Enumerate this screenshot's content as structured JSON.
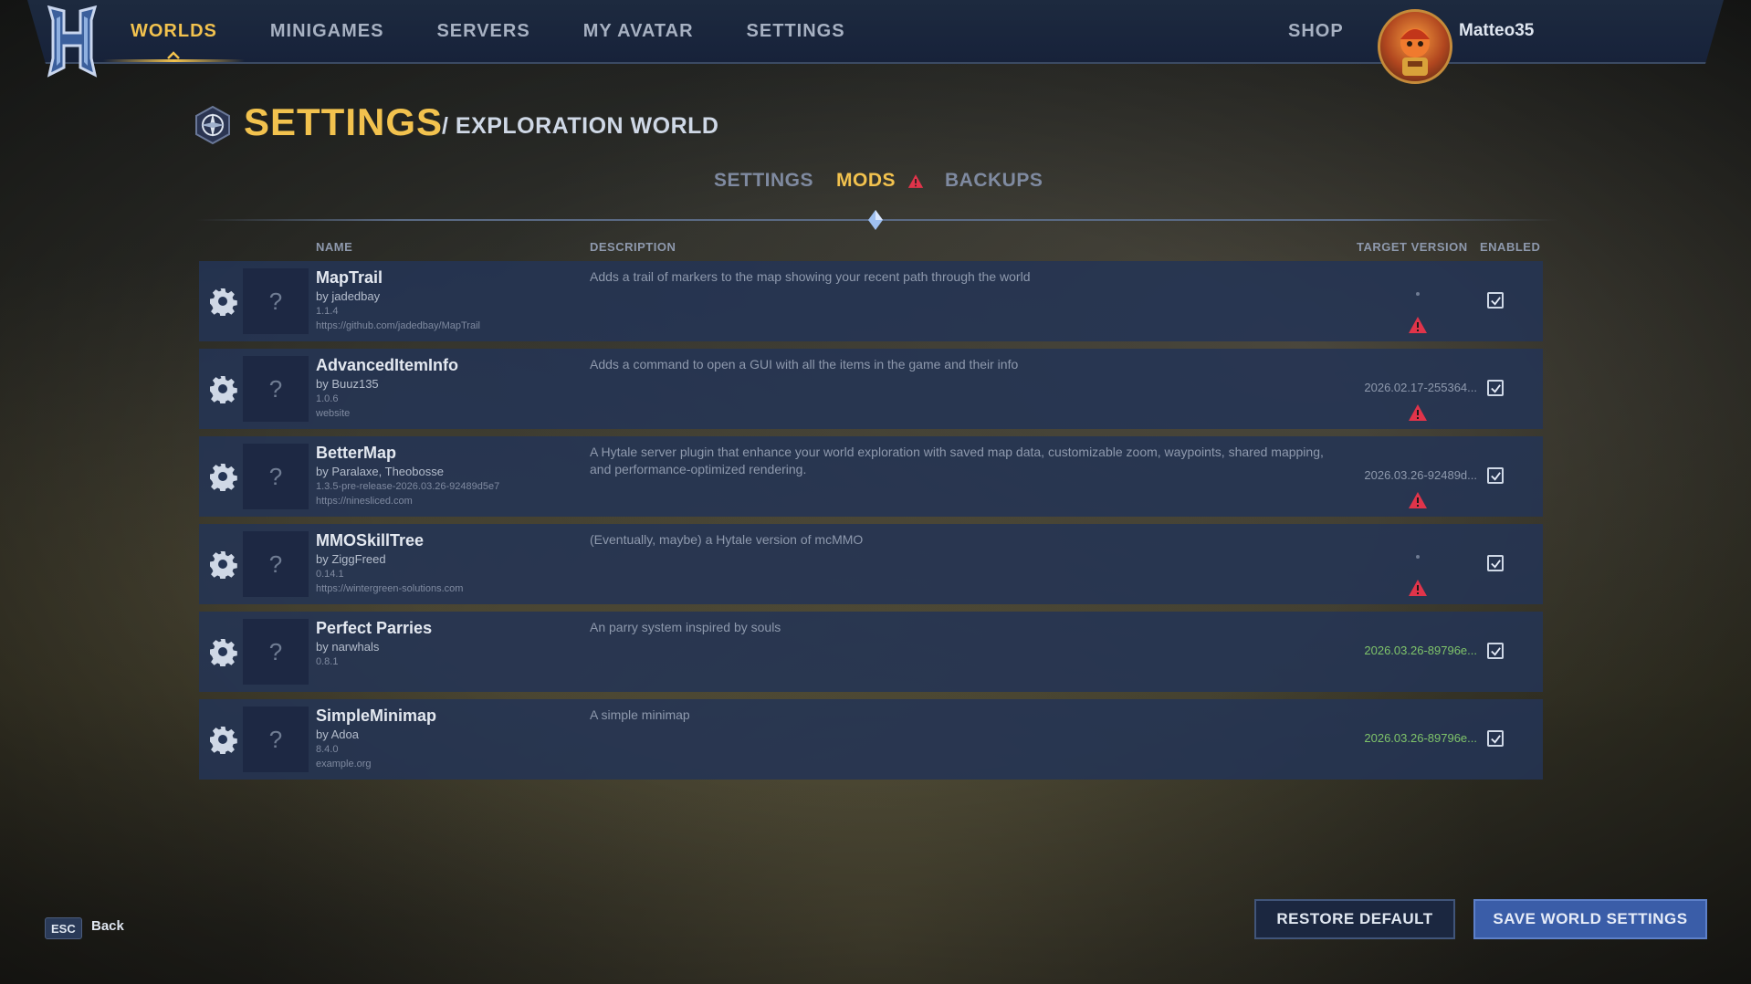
{
  "nav": {
    "items": [
      {
        "label": "WORLDS",
        "active": true
      },
      {
        "label": "MINIGAMES",
        "active": false
      },
      {
        "label": "SERVERS",
        "active": false
      },
      {
        "label": "MY AVATAR",
        "active": false
      },
      {
        "label": "SETTINGS",
        "active": false
      }
    ],
    "shop_label": "SHOP",
    "username": "Matteo35"
  },
  "header": {
    "title": "SETTINGS",
    "subtitle": "/ EXPLORATION WORLD"
  },
  "tabs": [
    {
      "label": "SETTINGS",
      "active": false
    },
    {
      "label": "MODS",
      "active": true,
      "warning": true
    },
    {
      "label": "BACKUPS",
      "active": false
    }
  ],
  "table": {
    "headers": {
      "name": "NAME",
      "description": "DESCRIPTION",
      "target_version": "TARGET VERSION",
      "enabled": "ENABLED"
    },
    "rows": [
      {
        "name": "MapTrail",
        "author": "by jadedbay",
        "version": "1.1.4",
        "link": "https://github.com/jadedbay/MapTrail",
        "description": "Adds a trail of markers to the map showing your recent path through the world",
        "target_version": "",
        "target_ok": false,
        "warning": true,
        "enabled": true
      },
      {
        "name": "AdvancedItemInfo",
        "author": "by Buuz135",
        "version": "1.0.6",
        "link": "website",
        "description": "Adds a command to open a GUI with all the items in the game and their info",
        "target_version": "2026.02.17-255364...",
        "target_ok": false,
        "warning": true,
        "enabled": true
      },
      {
        "name": "BetterMap",
        "author": "by Paralaxe, Theobosse",
        "version": "1.3.5-pre-release-2026.03.26-92489d5e7",
        "link": "https://ninesliced.com",
        "description": "A Hytale server plugin that enhance your world exploration with saved map data, customizable zoom, waypoints, shared mapping, and performance-optimized rendering.",
        "target_version": "2026.03.26-92489d...",
        "target_ok": false,
        "warning": true,
        "enabled": true
      },
      {
        "name": "MMOSkillTree",
        "author": "by ZiggFreed",
        "version": "0.14.1",
        "link": "https://wintergreen-solutions.com",
        "description": "(Eventually, maybe) a Hytale version of mcMMO",
        "target_version": "",
        "target_ok": false,
        "warning": true,
        "enabled": true
      },
      {
        "name": "Perfect Parries",
        "author": "by narwhals",
        "version": "0.8.1",
        "link": "",
        "description": "An parry system inspired by souls",
        "target_version": "2026.03.26-89796e...",
        "target_ok": true,
        "warning": false,
        "enabled": true
      },
      {
        "name": "SimpleMinimap",
        "author": "by Adoa",
        "version": "8.4.0",
        "link": "example.org",
        "description": "A simple minimap",
        "target_version": "2026.03.26-89796e...",
        "target_ok": true,
        "warning": false,
        "enabled": true
      }
    ]
  },
  "footer": {
    "esc_key": "ESC",
    "back_label": "Back",
    "restore_label": "RESTORE DEFAULT",
    "save_label": "SAVE WORLD SETTINGS"
  },
  "colors": {
    "accent": "#f2c24e",
    "warning": "#e0344a",
    "ok": "#7fc46a",
    "row_bg": "#243454",
    "primary_button": "#3a5da8"
  },
  "icons": {
    "logo": "hytale-logo",
    "page": "compass-icon",
    "row_settings": "gear-icon",
    "row_thumb": "question-mark-icon",
    "warning": "warning-triangle-icon",
    "enabled": "checkbox-checked-icon"
  }
}
